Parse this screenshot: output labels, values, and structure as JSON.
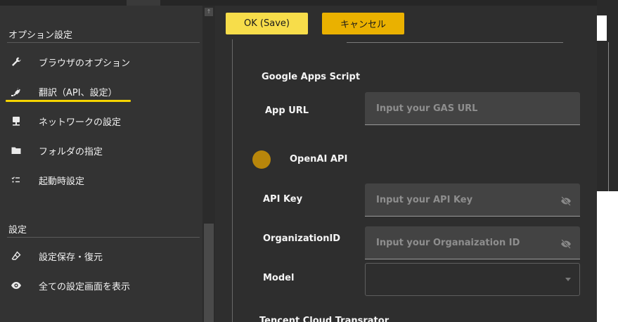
{
  "sidebar": {
    "section1_title": "オプション設定",
    "section2_title": "設定",
    "items": [
      {
        "label": "ブラウザのオプション",
        "icon": "wrench-icon"
      },
      {
        "label": "翻訳（API、設定）",
        "icon": "plug-icon"
      },
      {
        "label": "ネットワークの設定",
        "icon": "monitor-icon"
      },
      {
        "label": "フォルダの指定",
        "icon": "folder-icon"
      },
      {
        "label": "起動時設定",
        "icon": "checklist-icon"
      },
      {
        "label": "設定保存・復元",
        "icon": "eraser-icon"
      },
      {
        "label": "全ての設定画面を表示",
        "icon": "eye-icon"
      }
    ],
    "active_index": 1,
    "scroll_up_glyph": "↑"
  },
  "toolbar": {
    "ok_label": "OK (Save)",
    "cancel_label": "キャンセル"
  },
  "main": {
    "gas": {
      "title": "Google Apps Script",
      "app_url_label": "App URL",
      "app_url_placeholder": "Input your GAS URL"
    },
    "openai": {
      "title": "OpenAI API",
      "api_key_label": "API Key",
      "api_key_placeholder": "Input your API Key",
      "org_label": "OrganizationID",
      "org_placeholder": "Input your Organaization ID",
      "model_label": "Model",
      "model_value": ""
    },
    "next_section_title": "Tencent Cloud Transrator"
  },
  "colors": {
    "ok_button": "#f7dd4a",
    "cancel_button": "#eab100",
    "active_underline": "#f5d400",
    "toggle": "#b8860b",
    "background": "#2e2e2e",
    "sidebar_bg": "#333333"
  }
}
